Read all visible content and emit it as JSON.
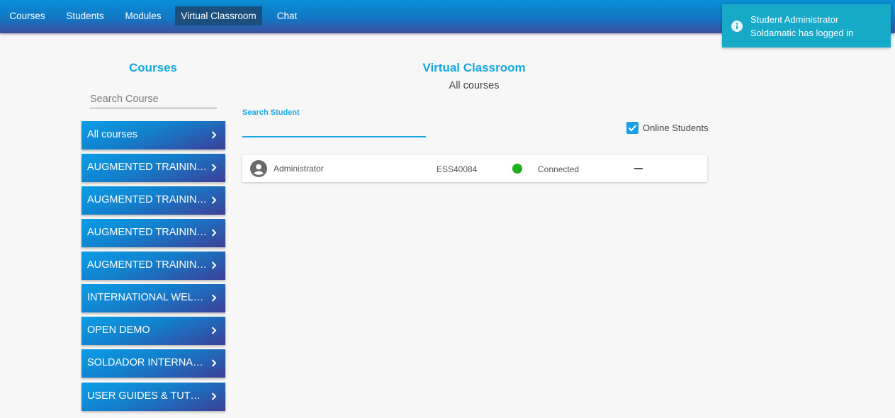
{
  "nav": {
    "items": [
      {
        "label": "Courses"
      },
      {
        "label": "Students"
      },
      {
        "label": "Modules"
      },
      {
        "label": "Virtual Classroom",
        "active": true
      },
      {
        "label": "Chat"
      }
    ]
  },
  "toast": {
    "line1": "Student Administrator",
    "line2": "Soldamatic has logged in"
  },
  "courses_panel": {
    "title": "Courses",
    "search_placeholder": "Search Course",
    "items": [
      {
        "label": "All courses"
      },
      {
        "label": "AUGMENTED TRAINING..."
      },
      {
        "label": "AUGMENTED TRAINING..."
      },
      {
        "label": "AUGMENTED TRAINING..."
      },
      {
        "label": "AUGMENTED TRAINING..."
      },
      {
        "label": "INTERNATIONAL WELDING..."
      },
      {
        "label": "OPEN DEMO"
      },
      {
        "label": "SOLDADOR INTERNACIONAL..."
      },
      {
        "label": "USER GUIDES & TUTORIALS..."
      }
    ]
  },
  "main": {
    "title": "Virtual Classroom",
    "subtitle": "All courses",
    "search_label": "Search Student",
    "online_label": "Online Students",
    "online_checked": true,
    "students": [
      {
        "name": "Administrator",
        "id": "ESS40084",
        "status": "Connected",
        "status_color": "#1db11d"
      }
    ]
  },
  "colors": {
    "accent": "#15a7e2",
    "toast_bg": "#17a9c8",
    "nav_active": "#1a4f7e"
  }
}
